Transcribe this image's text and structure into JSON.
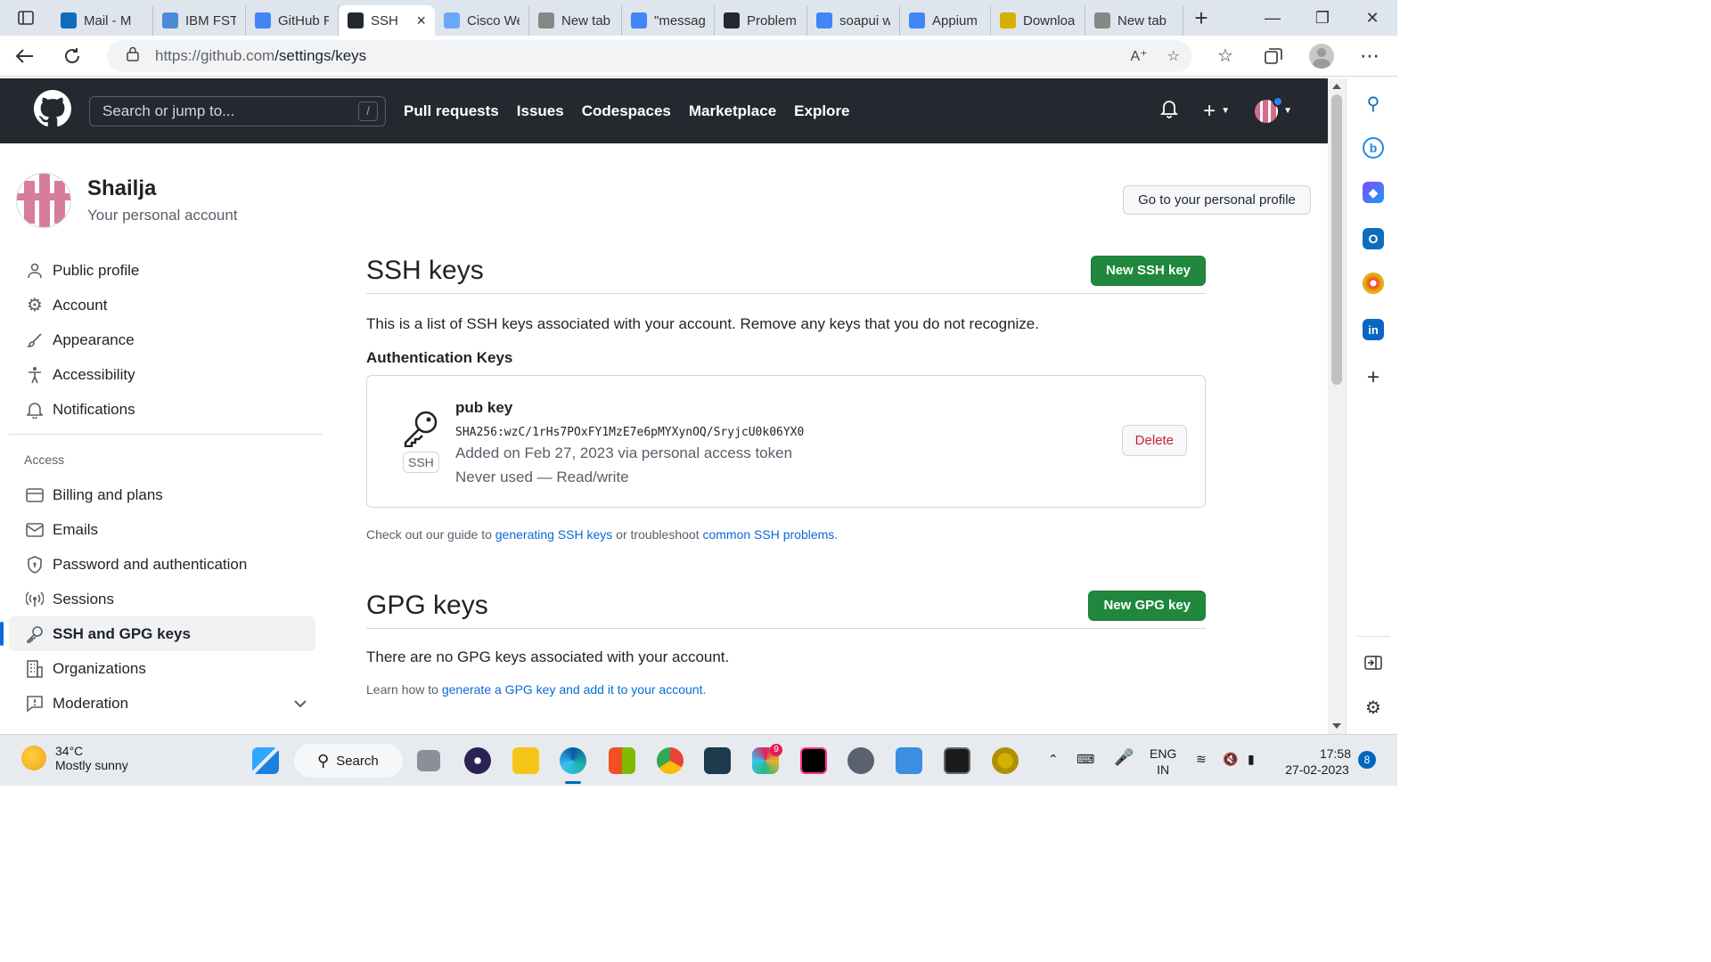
{
  "browser": {
    "tabs": [
      {
        "title": "Mail - M",
        "icon": "outlook-icon",
        "color": "#0f6cbd"
      },
      {
        "title": "IBM FST",
        "icon": "a-icon",
        "color": "#4b8bd6"
      },
      {
        "title": "GitHub R",
        "icon": "docs-icon",
        "color": "#4285f4"
      },
      {
        "title": "SSH",
        "icon": "github-icon",
        "color": "#24292f",
        "active": true
      },
      {
        "title": "Cisco We",
        "icon": "webex-icon",
        "color": "#6aa8f7"
      },
      {
        "title": "New tab",
        "icon": "newtab-icon",
        "color": "#888888"
      },
      {
        "title": "\"messag",
        "icon": "google-icon",
        "color": "#4285f4"
      },
      {
        "title": "Problem:",
        "icon": "github-icon",
        "color": "#24292f"
      },
      {
        "title": "soapui w",
        "icon": "google-icon",
        "color": "#4285f4"
      },
      {
        "title": "Appium",
        "icon": "docs-icon",
        "color": "#4285f4"
      },
      {
        "title": "Downloa",
        "icon": "download-site-icon",
        "color": "#d4b100"
      },
      {
        "title": "New tab",
        "icon": "newtab-icon",
        "color": "#888888"
      }
    ],
    "url_host": "https://github.com",
    "url_path": "/settings/keys"
  },
  "header": {
    "search_placeholder": "Search or jump to...",
    "search_shortcut": "/",
    "nav": [
      "Pull requests",
      "Issues",
      "Codespaces",
      "Marketplace",
      "Explore"
    ],
    "plus_label": "+"
  },
  "profile": {
    "username": "Shailja",
    "subtitle": "Your personal account",
    "go_profile_button": "Go to your personal profile"
  },
  "sidebar": {
    "items": [
      {
        "label": "Public profile",
        "icon": "person-icon"
      },
      {
        "label": "Account",
        "icon": "gear-icon"
      },
      {
        "label": "Appearance",
        "icon": "paintbrush-icon"
      },
      {
        "label": "Accessibility",
        "icon": "accessibility-icon"
      },
      {
        "label": "Notifications",
        "icon": "bell-icon"
      }
    ],
    "access_heading": "Access",
    "access_items": [
      {
        "label": "Billing and plans",
        "icon": "credit-card-icon"
      },
      {
        "label": "Emails",
        "icon": "mail-icon"
      },
      {
        "label": "Password and authentication",
        "icon": "shield-lock-icon"
      },
      {
        "label": "Sessions",
        "icon": "broadcast-icon"
      },
      {
        "label": "SSH and GPG keys",
        "icon": "key-icon",
        "selected": true
      },
      {
        "label": "Organizations",
        "icon": "organization-icon"
      },
      {
        "label": "Moderation",
        "icon": "report-icon"
      }
    ]
  },
  "ssh": {
    "title": "SSH keys",
    "new_button": "New SSH key",
    "description": "This is a list of SSH keys associated with your account. Remove any keys that you do not recognize.",
    "auth_heading": "Authentication Keys",
    "key": {
      "badge": "SSH",
      "name": "pub key",
      "fingerprint": "SHA256:wzC/1rHs7POxFY1MzE7e6pMYXynOQ/SryjcU0k06YX0",
      "added": "Added on Feb 27, 2023 via personal access token",
      "usage": "Never used — Read/write",
      "delete_button": "Delete"
    },
    "note_prefix": "Check out our guide to ",
    "note_link1": "generating SSH keys",
    "note_mid": " or troubleshoot ",
    "note_link2": "common SSH problems",
    "note_suffix": "."
  },
  "gpg": {
    "title": "GPG keys",
    "new_button": "New GPG key",
    "empty": "There are no GPG keys associated with your account.",
    "learn_prefix": "Learn how to ",
    "learn_link": "generate a GPG key and add it to your account",
    "learn_suffix": "."
  },
  "taskbar": {
    "temp": "34°C",
    "weather": "Mostly sunny",
    "search_label": "Search",
    "lang1": "ENG",
    "lang2": "IN",
    "time": "17:58",
    "date": "27-02-2023",
    "notifications": "8",
    "slack_badge": "9"
  },
  "colors": {
    "github_header": "#24292f",
    "primary_button": "#1f883d",
    "link": "#0969da",
    "danger": "#cf222e",
    "selected_indicator": "#0969da"
  }
}
